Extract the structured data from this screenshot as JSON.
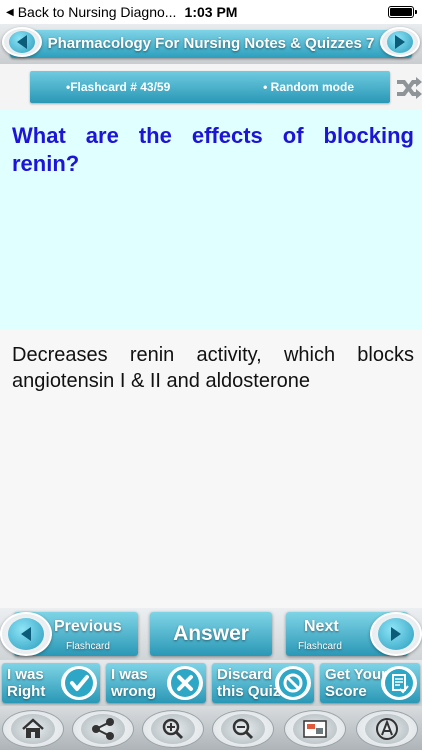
{
  "status_bar": {
    "back_label": "Back to Nursing Diagno...",
    "time": "1:03 PM"
  },
  "header": {
    "title": "Pharmacology For Nursing  Notes & Quizzes 7"
  },
  "info_bar": {
    "flashcard_label": "•Flashcard #  43/59",
    "mode_label": "• Random mode"
  },
  "question": {
    "text": "What are the effects of blocking renin?"
  },
  "answer": {
    "text": "Decreases renin activity, which blocks angiotensin I & II and aldosterone"
  },
  "nav": {
    "previous_label": "Previous",
    "previous_sub": "Flashcard",
    "answer_label": "Answer",
    "next_label": "Next",
    "next_sub": "Flashcard"
  },
  "actions": {
    "right_line1": "I was",
    "right_line2": "Right",
    "wrong_line1": "I was",
    "wrong_line2": "wrong",
    "discard_line1": "Discard",
    "discard_line2": "this Quiz",
    "score_line1": "Get Your",
    "score_line2": "Score"
  },
  "toolbar": {
    "icons": [
      "home-icon",
      "share-icon",
      "zoom-in-icon",
      "zoom-out-icon",
      "background-icon",
      "font-icon"
    ]
  },
  "colors": {
    "accent": "#2a98b6",
    "question_bg": "#e0ffff",
    "question_text": "#1c14d6",
    "answer_text": "#111111"
  }
}
